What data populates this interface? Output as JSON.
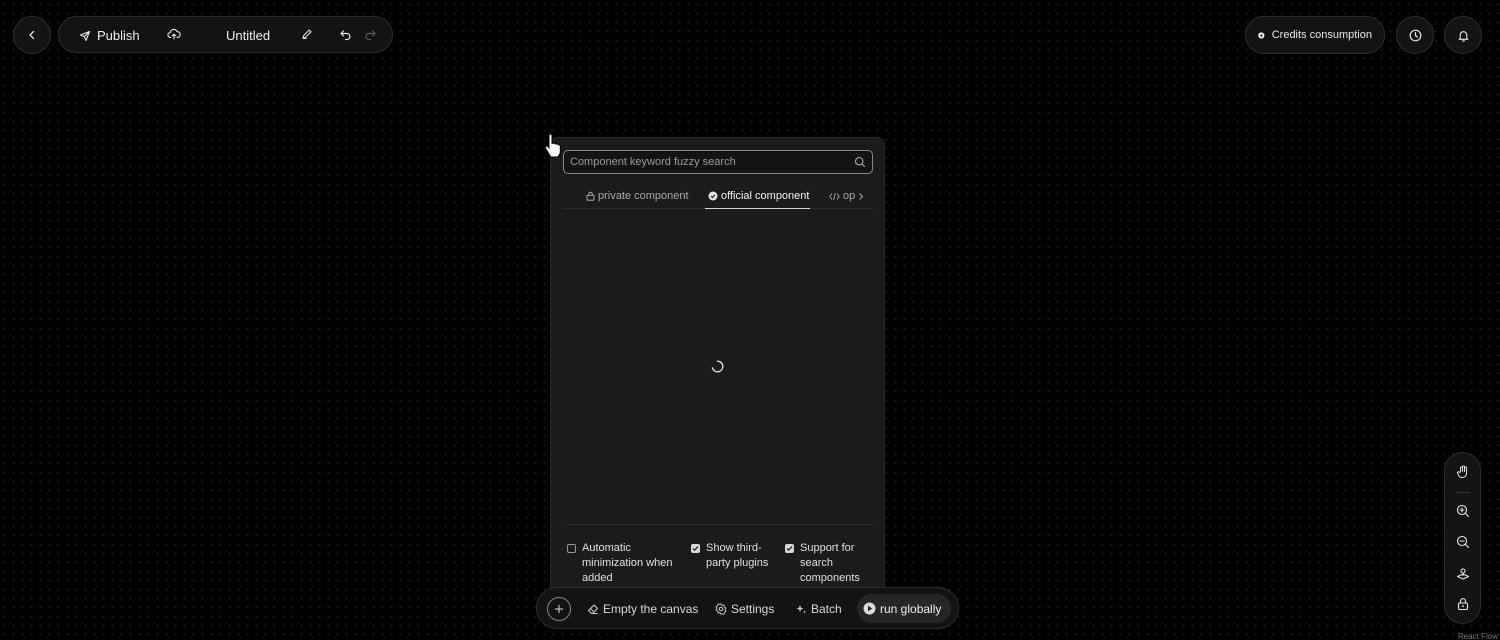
{
  "header": {
    "publish_label": "Publish",
    "title": "Untitled",
    "credits_label": "Credits consumption"
  },
  "panel": {
    "search_placeholder": "Component keyword fuzzy search",
    "tabs": [
      {
        "label": "private component",
        "icon": "lock-icon"
      },
      {
        "label": "official component",
        "icon": "official-badge-icon",
        "active": true
      },
      {
        "label": "op",
        "icon": "code-icon"
      }
    ],
    "options": [
      {
        "label": "Automatic minimization when added",
        "checked": false
      },
      {
        "label": "Show third-party plugins",
        "checked": true
      },
      {
        "label": "Support for search components",
        "checked": true
      }
    ]
  },
  "bottom_bar": {
    "empty_canvas": "Empty the canvas",
    "settings": "Settings",
    "batch": "Batch",
    "run_globally": "run globally"
  },
  "attribution": "React Flow",
  "colors": {
    "background": "#000000",
    "panel": "#1b1b1b",
    "border": "#2e2e2e",
    "text": "#e8e8e8"
  }
}
